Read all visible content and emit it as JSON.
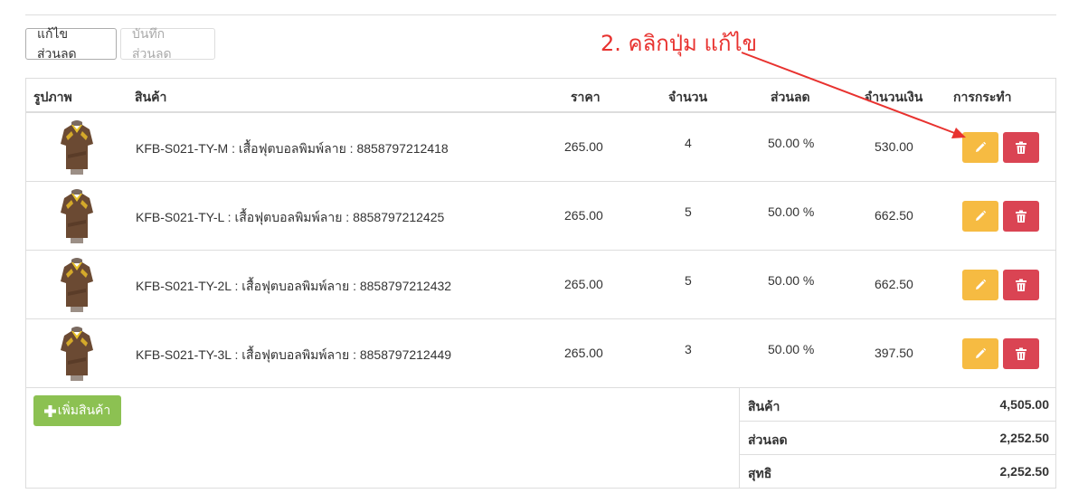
{
  "toolbar": {
    "edit_discount_label": "แก้ไขส่วนลด",
    "save_discount_label": "บันทึกส่วนลด"
  },
  "annotation": {
    "text": "2. คลิกปุ่ม แก้ไข",
    "color": "#e8322f"
  },
  "table": {
    "headers": {
      "image": "รูปภาพ",
      "product": "สินค้า",
      "price": "ราคา",
      "qty": "จำนวน",
      "discount": "ส่วนลด",
      "amount": "จำนวนเงิน",
      "actions": "การกระทำ"
    },
    "rows": [
      {
        "product": "KFB-S021-TY-M : เสื้อฟุตบอลพิมพ์ลาย : 8858797212418",
        "price": "265.00",
        "qty": "4",
        "discount": "50.00 %",
        "amount": "530.00"
      },
      {
        "product": "KFB-S021-TY-L : เสื้อฟุตบอลพิมพ์ลาย : 8858797212425",
        "price": "265.00",
        "qty": "5",
        "discount": "50.00 %",
        "amount": "662.50"
      },
      {
        "product": "KFB-S021-TY-2L : เสื้อฟุตบอลพิมพ์ลาย : 8858797212432",
        "price": "265.00",
        "qty": "5",
        "discount": "50.00 %",
        "amount": "662.50"
      },
      {
        "product": "KFB-S021-TY-3L : เสื้อฟุตบอลพิมพ์ลาย : 8858797212449",
        "price": "265.00",
        "qty": "3",
        "discount": "50.00 %",
        "amount": "397.50"
      }
    ],
    "edit_icon": "pencil-icon",
    "delete_icon": "trash-icon"
  },
  "add_product": {
    "label": "เพิ่มสินค้า",
    "icon": "plus-icon"
  },
  "summary": {
    "products_label": "สินค้า",
    "products_value": "4,505.00",
    "discount_label": "ส่วนลด",
    "discount_value": "2,252.50",
    "net_label": "สุทธิ",
    "net_value": "2,252.50"
  },
  "colors": {
    "edit": "#f6bb42",
    "delete": "#da4453",
    "add": "#8cc152"
  }
}
